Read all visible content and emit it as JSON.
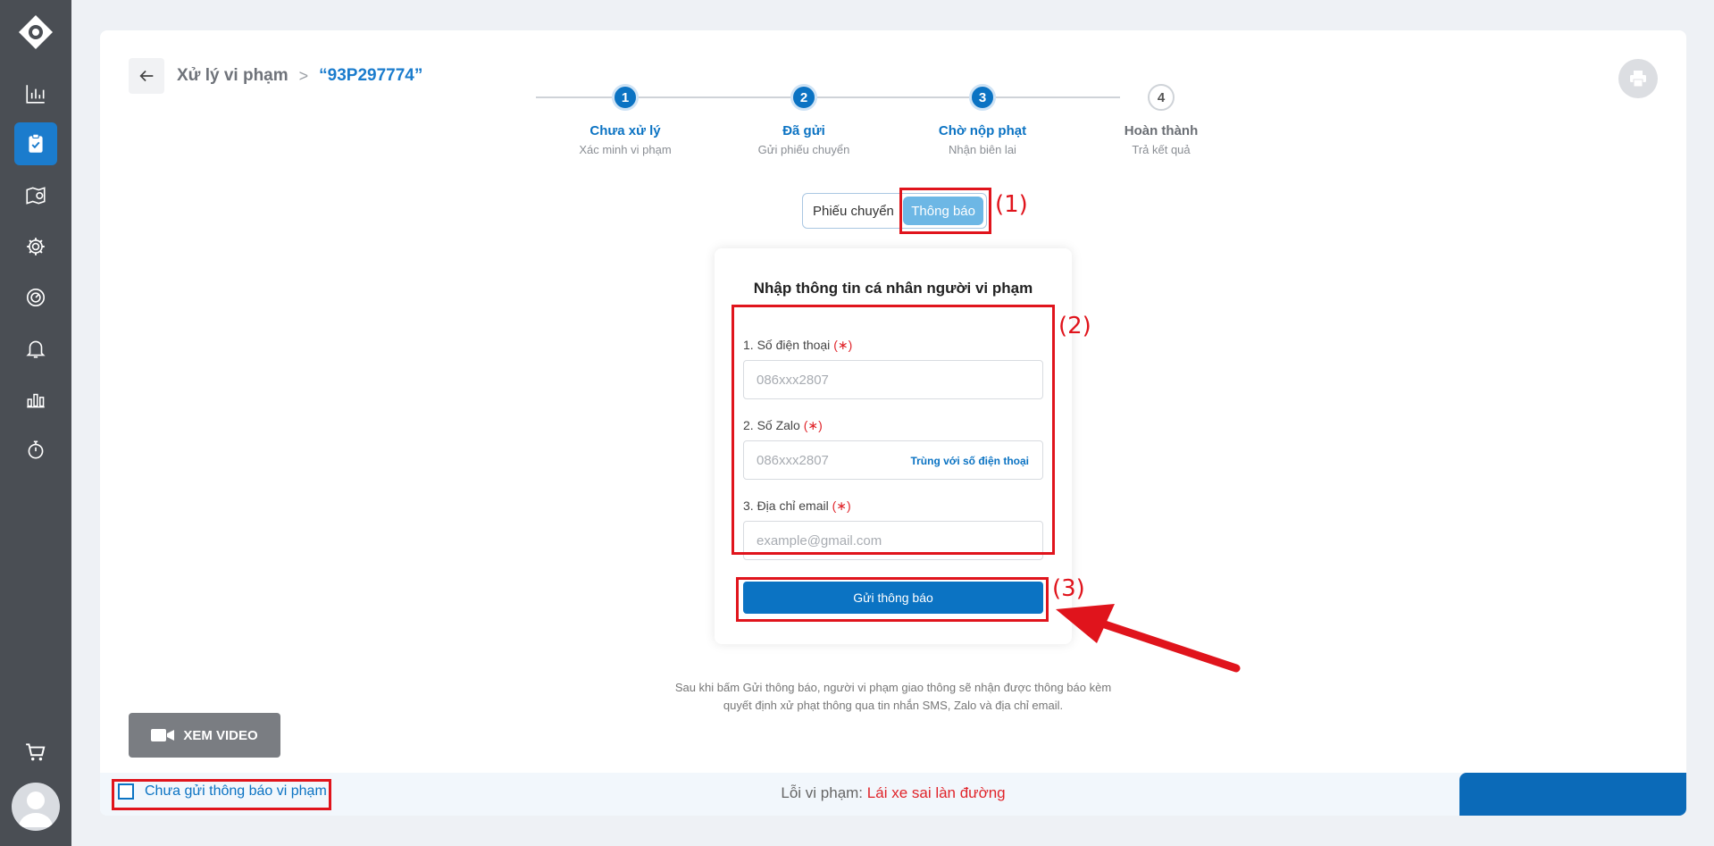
{
  "breadcrumb": {
    "parent": "Xử lý vi phạm",
    "separator": ">",
    "current": "“93P297774”"
  },
  "steps": [
    {
      "number": "1",
      "title": "Chưa xử lý",
      "subtitle": "Xác minh vi phạm",
      "state": "done"
    },
    {
      "number": "2",
      "title": "Đã gửi",
      "subtitle": "Gửi phiếu chuyển",
      "state": "done"
    },
    {
      "number": "3",
      "title": "Chờ nộp phạt",
      "subtitle": "Nhận biên lai",
      "state": "done"
    },
    {
      "number": "4",
      "title": "Hoàn thành",
      "subtitle": "Trả kết quả",
      "state": "todo"
    }
  ],
  "toggle": {
    "option1": "Phiếu chuyển",
    "option2": "Thông báo",
    "selected": "Thông báo"
  },
  "form": {
    "title": "Nhập thông tin cá nhân người vi phạm",
    "required_mark": "(∗)",
    "phone": {
      "label": "1. Số điện thoại",
      "placeholder": "086xxx2807",
      "value": ""
    },
    "zalo": {
      "label": "2. Số Zalo",
      "placeholder": "086xxx2807",
      "value": "",
      "same_link": "Trùng với số điện thoại"
    },
    "email": {
      "label": "3. Địa chỉ email",
      "placeholder": "example@gmail.com",
      "value": ""
    },
    "submit": "Gửi thông báo"
  },
  "note": {
    "line1": "Sau khi bấm Gửi thông báo, người vi phạm giao thông sẽ nhận được thông báo kèm",
    "line2": "quyết định xử phạt thông qua tin nhắn SMS, Zalo và địa chỉ email."
  },
  "video_button": "XEM VIDEO",
  "bottom_bar": {
    "checkbox_label": "Chưa gửi thông báo vi phạm",
    "checked": false,
    "violation_label": "Lỗi vi phạm:",
    "violation_value": "Lái xe sai làn đường"
  },
  "annotations": {
    "a1": "(1)",
    "a2": "(2)",
    "a3": "(3)"
  },
  "sidebar": {
    "items": [
      "chart-icon",
      "clipboard-check-icon",
      "map-pin-icon",
      "gear-icon",
      "speedometer-icon",
      "bell-icon",
      "bar-stats-icon",
      "timer-icon"
    ],
    "active": "clipboard-check-icon",
    "bottom": [
      "cart-icon",
      "avatar"
    ]
  },
  "colors": {
    "primary": "#0b73c3",
    "sidebar": "#4a4e54",
    "annotation": "#e0141c",
    "toggle_active": "#6db7e5"
  }
}
